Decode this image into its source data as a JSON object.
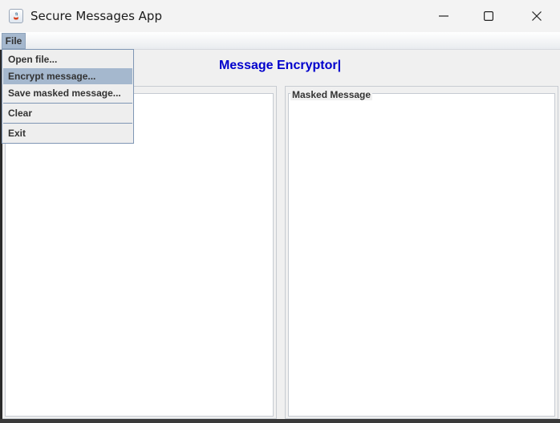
{
  "window": {
    "title": "Secure Messages App",
    "icon": "java-app-icon",
    "controls": [
      "minimize-icon",
      "maximize-icon",
      "close-icon"
    ]
  },
  "menubar": {
    "items": [
      {
        "label": "File"
      }
    ]
  },
  "file_menu": {
    "items": [
      {
        "label": "Open file..."
      },
      {
        "label": "Encrypt message..."
      },
      {
        "label": "Save masked message..."
      },
      {
        "label": "Clear"
      },
      {
        "label": "Exit"
      }
    ],
    "highlighted": "Encrypt message..."
  },
  "main": {
    "title": "Message Encryptor|",
    "left_panel": {
      "label": "",
      "content": ""
    },
    "right_panel": {
      "label": "Masked Message",
      "content": ""
    }
  },
  "colors": {
    "title_blue": "#0000cc",
    "menu_highlight": "#a5b8ce",
    "menu_border": "#7f96b4"
  }
}
